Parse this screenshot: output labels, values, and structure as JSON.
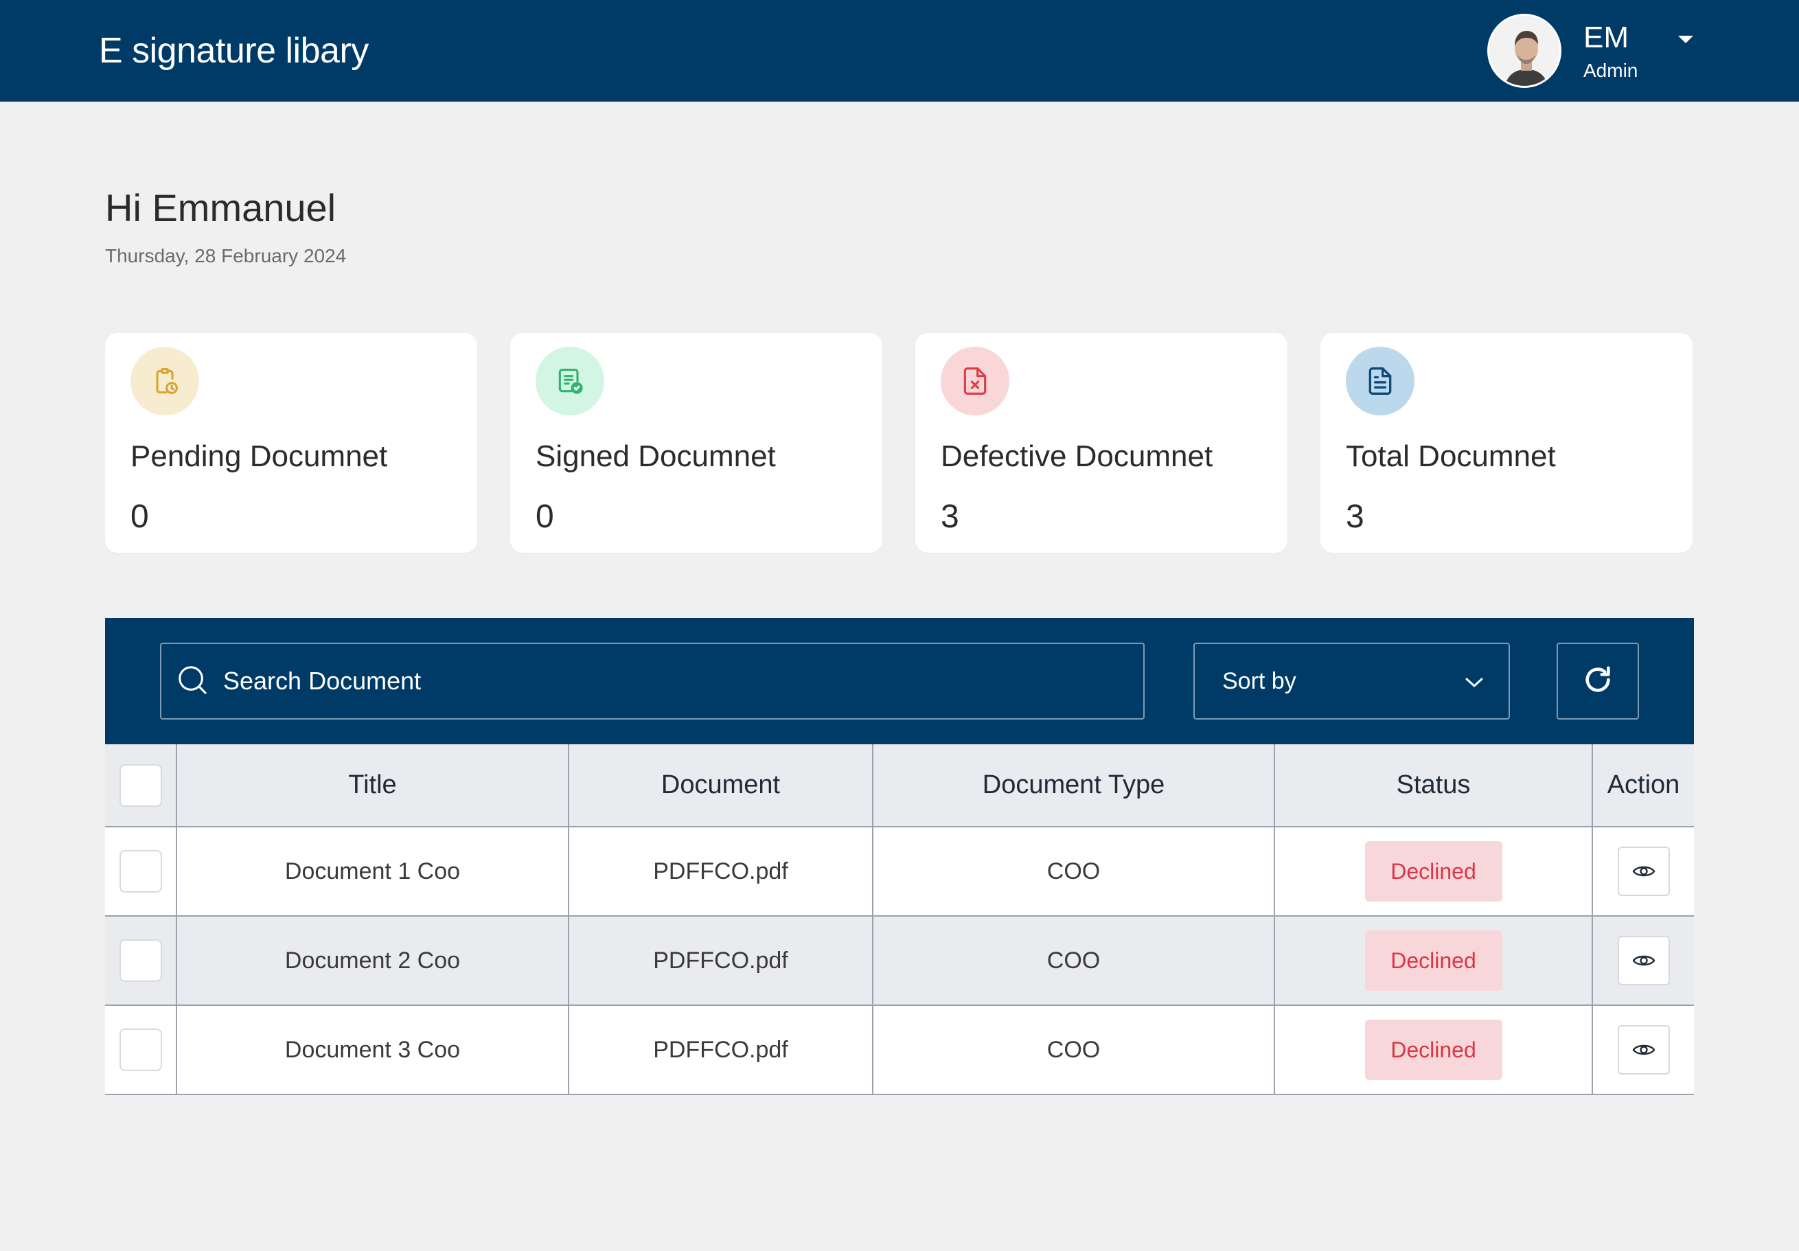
{
  "header": {
    "app_title": "E signature libary",
    "user_initials": "EM",
    "user_role": "Admin"
  },
  "greeting": {
    "title": "Hi Emmanuel",
    "date": "Thursday, 28 February 2024"
  },
  "stats": [
    {
      "label": "Pending Documnet",
      "value": "0",
      "icon": "clipboard-clock-icon",
      "icon_bg": "#f7ecd0",
      "icon_color": "#d6a531"
    },
    {
      "label": "Signed Documnet",
      "value": "0",
      "icon": "document-check-icon",
      "icon_bg": "#d3f5e3",
      "icon_color": "#2fb36e"
    },
    {
      "label": "Defective Documnet",
      "value": "3",
      "icon": "file-x-icon",
      "icon_bg": "#f9d6d8",
      "icon_color": "#e03a46"
    },
    {
      "label": "Total Documnet",
      "value": "3",
      "icon": "file-text-icon",
      "icon_bg": "#bcd8ec",
      "icon_color": "#0e4a78"
    }
  ],
  "toolbar": {
    "search_placeholder": "Search Document",
    "sort_label": "Sort by"
  },
  "table": {
    "columns": [
      "Title",
      "Document",
      "Document Type",
      "Status",
      "Action"
    ],
    "rows": [
      {
        "title": "Document 1 Coo",
        "document": "PDFFCO.pdf",
        "type": "COO",
        "status": "Declined"
      },
      {
        "title": "Document 2 Coo",
        "document": "PDFFCO.pdf",
        "type": "COO",
        "status": "Declined"
      },
      {
        "title": "Document 3 Coo",
        "document": "PDFFCO.pdf",
        "type": "COO",
        "status": "Declined"
      }
    ]
  },
  "colors": {
    "primary": "#003b67",
    "background": "#f0f0f0",
    "declined_bg": "#f8d7da",
    "declined_text": "#dc3545"
  }
}
